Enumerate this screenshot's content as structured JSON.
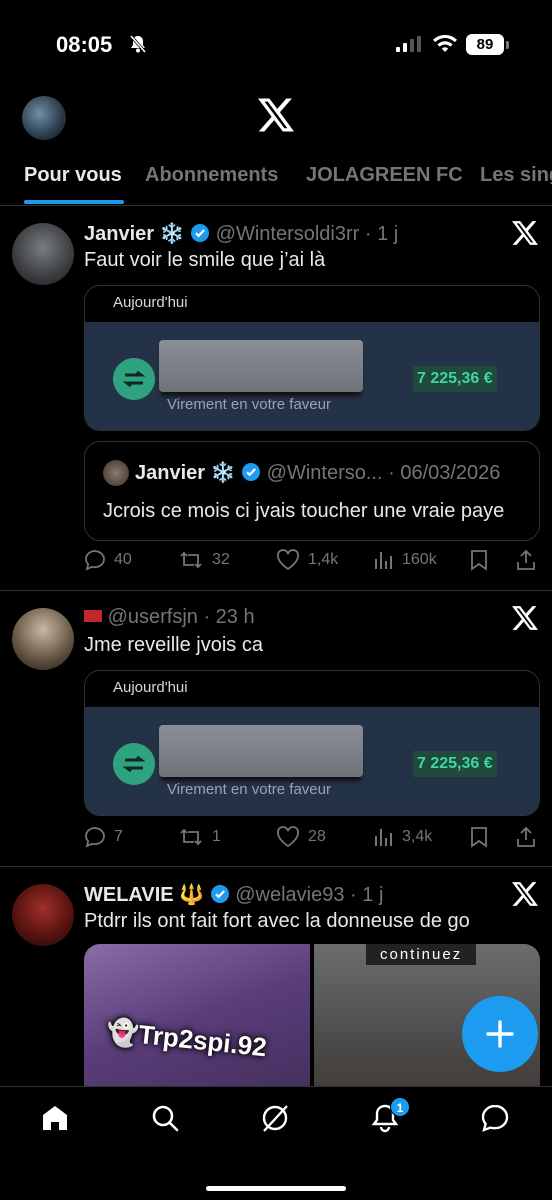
{
  "status_bar": {
    "time": "08:05",
    "battery": "89"
  },
  "tabs": [
    "Pour vous",
    "Abonnements",
    "JOLAGREEN FC",
    "Les sing"
  ],
  "posts": [
    {
      "name": "Janvier",
      "emoji": "❄️",
      "handle": "@Wintersoldi3rr",
      "time": "· 1 j",
      "text": "Faut voir le smile que j’ai là",
      "bank": {
        "header": "Aujourd'hui",
        "amount": "7 225,36 €",
        "subtitle": "Virement en votre faveur"
      },
      "quote": {
        "name": "Janvier",
        "emoji": "❄️",
        "handle": "@Winterso...",
        "date": "· 06/03/2026",
        "text": "Jcrois ce mois ci jvais toucher une vraie paye"
      },
      "stats": {
        "replies": "40",
        "reposts": "32",
        "likes": "1,4k",
        "views": "160k"
      }
    },
    {
      "name": "",
      "handle": "@userfsjn",
      "time": "· 23 h",
      "text": "Jme reveille jvois ca",
      "bank": {
        "header": "Aujourd'hui",
        "amount": "7 225,36 €",
        "subtitle": "Virement en votre faveur"
      },
      "stats": {
        "replies": "7",
        "reposts": "1",
        "likes": "28",
        "views": "3,4k"
      }
    },
    {
      "name": "WELAVIE",
      "emoji": "🔱",
      "handle": "@welavie93",
      "time": "· 1 j",
      "text": "Ptdrr ils ont fait fort avec la donneuse de go",
      "media": {
        "left_watermark": "👻Trp2spi.92",
        "right_caption": "continuez"
      }
    }
  ],
  "notifications_badge": "1",
  "colors": {
    "accent": "#1d9bf0",
    "bank_bg": "#243247",
    "amount": "#3ed6a4"
  }
}
